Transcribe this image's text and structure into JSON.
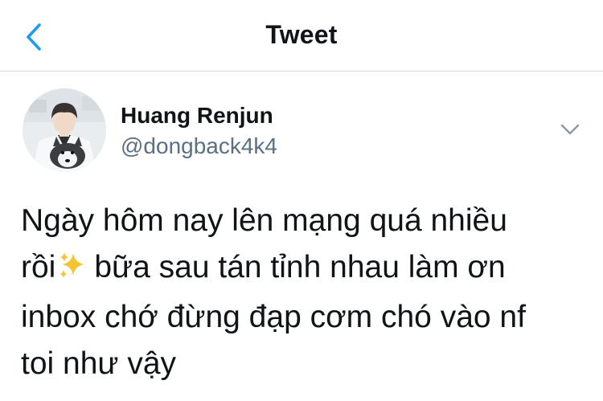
{
  "header": {
    "title": "Tweet"
  },
  "tweet": {
    "author": {
      "name": "Huang Renjun",
      "handle": "@dongback4k4"
    },
    "text_lines": [
      "Ngày hôm nay lên mạng quá nhiều",
      "rồi",
      "bữa sau tán tỉnh nhau làm ơn",
      "inbox chớ đừng đạp cơm chó vào nf",
      "toi như vậy"
    ],
    "emoji": "sparkles-icon"
  },
  "colors": {
    "accent": "#1d9bf0",
    "secondary_text": "#5b7083",
    "divider": "#cfd9de",
    "caret": "#8b98a5"
  }
}
